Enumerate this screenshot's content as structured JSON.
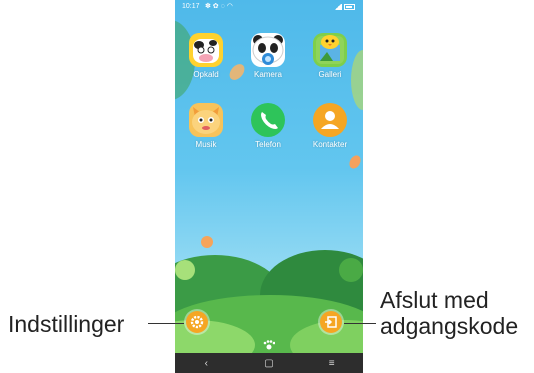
{
  "status_bar": {
    "time": "10:17"
  },
  "apps": [
    {
      "label": "Opkald",
      "icon": "cow-icon"
    },
    {
      "label": "Kamera",
      "icon": "panda-icon"
    },
    {
      "label": "Galleri",
      "icon": "chick-icon"
    },
    {
      "label": "Musik",
      "icon": "cat-icon"
    },
    {
      "label": "Telefon",
      "icon": "phone-icon"
    },
    {
      "label": "Kontakter",
      "icon": "contact-icon"
    }
  ],
  "callouts": {
    "settings": "Indstillinger",
    "exit_line1": "Afslut med",
    "exit_line2": "adgangskode"
  },
  "nav": {
    "back": "‹",
    "home": "▢",
    "menu": "≡"
  },
  "colors": {
    "accent": "#f5a623",
    "sky": "#4fb9ea",
    "grass": "#3aa53a"
  }
}
